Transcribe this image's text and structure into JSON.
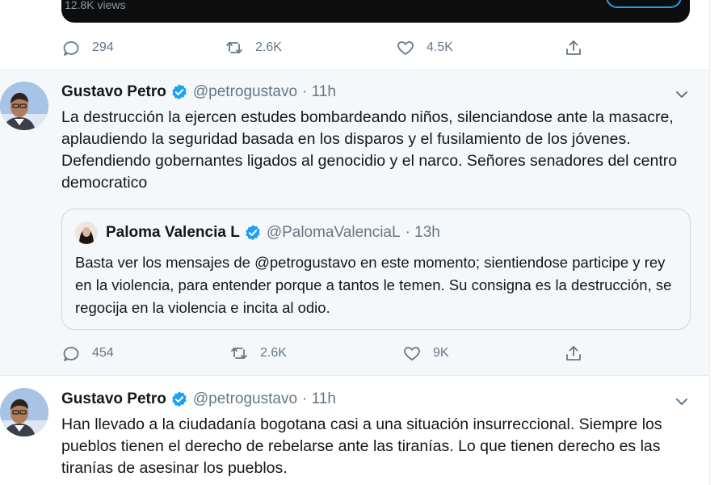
{
  "top_tweet": {
    "views_text": "12.8K views",
    "replies": "294",
    "retweets": "2.6K",
    "likes": "4.5K"
  },
  "tweet1": {
    "name": "Gustavo Petro",
    "handle": "@petrogustavo",
    "time": "· 11h",
    "text": "La destrucción la ejercen estudes bombardeando niños, silenciandose ante la masacre, aplaudiendo la seguridad basada en los disparos y el fusilamiento de los jóvenes. Defendiendo gobernantes ligados al genocidio y el narco. Señores senadores del centro democratico",
    "quote": {
      "name": "Paloma Valencia L",
      "handle": "@PalomaValenciaL",
      "time": "· 13h",
      "text": "Basta ver los mensajes de @petrogustavo en este momento; sientiendose participe y rey en la violencia, para entender porque a tantos le temen. Su consigna es la destrucción, se regocija en la violencia e incita al odio."
    },
    "replies": "454",
    "retweets": "2.6K",
    "likes": "9K"
  },
  "tweet2": {
    "name": "Gustavo Petro",
    "handle": "@petrogustavo",
    "time": "· 11h",
    "text": "Han llevado a la ciudadanía bogotana casi a una situación insurreccional. Siempre los pueblos tienen el derecho de rebelarse ante las tiranías. Lo que tienen derecho es las tiranías de asesinar los pueblos."
  },
  "colors": {
    "accent": "#1da1f2",
    "muted": "#657786",
    "highlight_bg": "#f5f8fa",
    "border": "#e6ecf0"
  }
}
